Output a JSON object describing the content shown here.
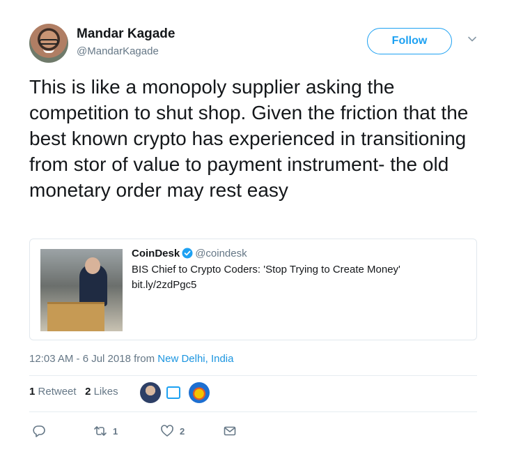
{
  "header": {
    "name": "Mandar Kagade",
    "handle": "@MandarKagade",
    "follow_label": "Follow",
    "menu_icon": "chevron-down-icon"
  },
  "tweet": {
    "text": "This is like a monopoly supplier asking the competition to shut shop. Given the friction that the best known crypto has experienced in transitioning from stor of value to payment instrument- the old monetary order may rest easy"
  },
  "quote": {
    "name": "CoinDesk",
    "verified_icon": "verified-badge-icon",
    "handle": "@coindesk",
    "text": "BIS Chief to Crypto Coders: 'Stop Trying to Create Money'",
    "link": "bit.ly/2zdPgc5"
  },
  "meta": {
    "time": "12:03 AM - 6 Jul 2018 from ",
    "location": "New Delhi, India"
  },
  "stats": {
    "retweets_count": "1",
    "retweets_label": "Retweet",
    "likes_count": "2",
    "likes_label": "Likes"
  },
  "actions": {
    "reply_count": "",
    "retweet_count": "1",
    "like_count": "2"
  },
  "colors": {
    "accent": "#1da1f2",
    "link": "#1b95e0",
    "muted": "#657786"
  }
}
